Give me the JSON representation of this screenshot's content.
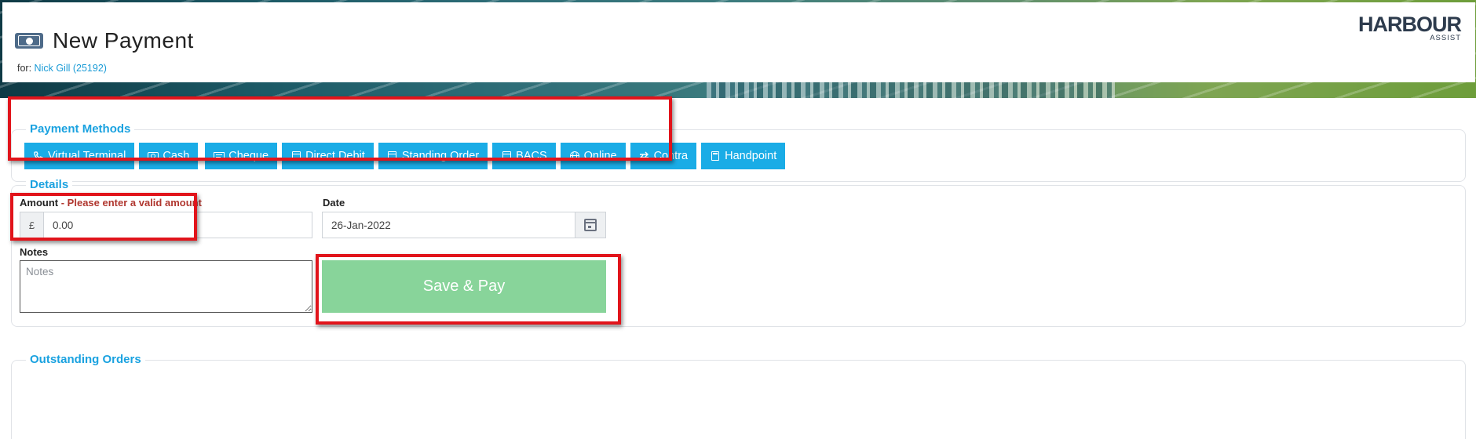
{
  "header": {
    "title": "New Payment",
    "subtitle_prefix": "for:",
    "customer_link": "Nick Gill (25192)",
    "logo_main": "HARBOUR",
    "logo_sub": "ASSIST"
  },
  "payment_methods": {
    "legend": "Payment Methods",
    "buttons": [
      {
        "label": "Virtual Terminal",
        "icon": "phone-icon"
      },
      {
        "label": "Cash",
        "icon": "cash-icon"
      },
      {
        "label": "Cheque",
        "icon": "cheque-icon"
      },
      {
        "label": "Direct Debit",
        "icon": "calendar-icon"
      },
      {
        "label": "Standing Order",
        "icon": "calendar-icon"
      },
      {
        "label": "BACS",
        "icon": "calendar-icon"
      },
      {
        "label": "Online",
        "icon": "globe-icon"
      },
      {
        "label": "Contra",
        "icon": "exchange-icon"
      },
      {
        "label": "Handpoint",
        "icon": "calculator-icon"
      }
    ]
  },
  "details": {
    "legend": "Details",
    "amount_label": "Amount",
    "amount_error": "- Please enter a valid amount",
    "currency_symbol": "£",
    "amount_value": "0.00",
    "date_label": "Date",
    "date_value": "26-Jan-2022",
    "notes_label": "Notes",
    "notes_placeholder": "Notes",
    "save_label": "Save & Pay"
  },
  "outstanding_orders": {
    "legend": "Outstanding Orders"
  },
  "colors": {
    "accent": "#1aace6",
    "legend": "#1aa2e0",
    "error": "#b0372f",
    "save_button": "#88d49a",
    "highlight": "#e1141b"
  }
}
